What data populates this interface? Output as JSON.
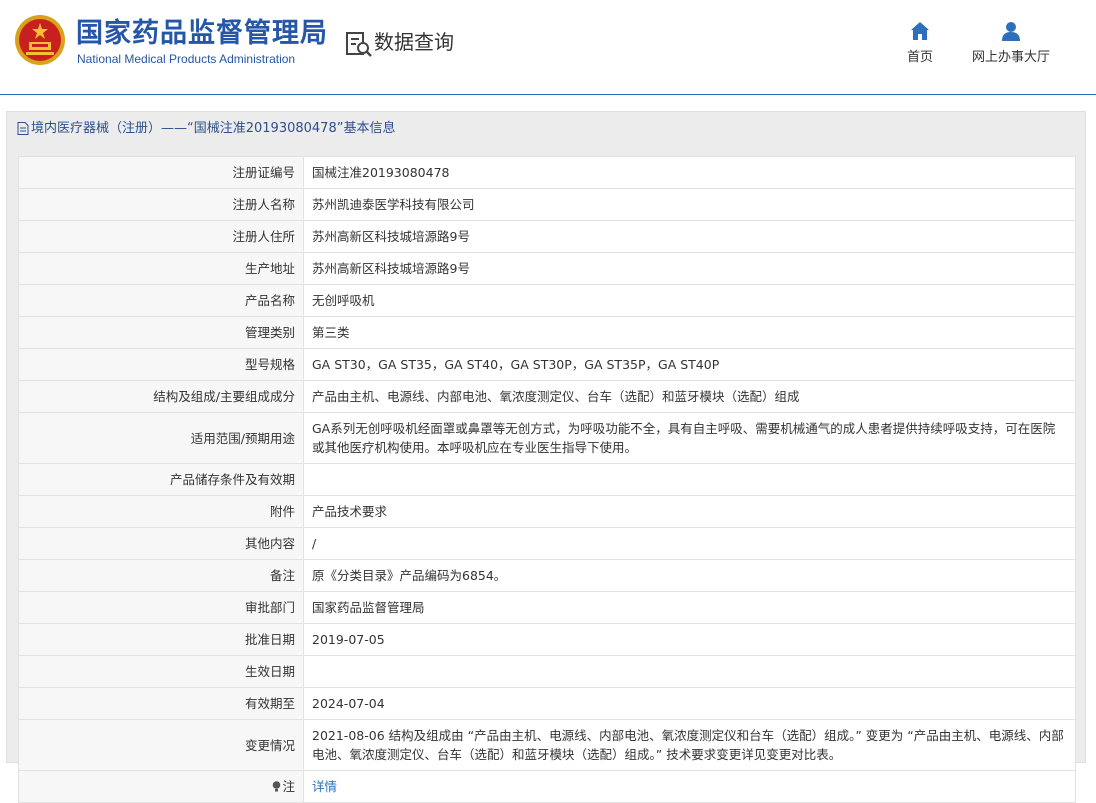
{
  "header": {
    "brand_cn": "国家药品监督管理局",
    "brand_en": "National Medical Products Administration",
    "query_title": "数据查询",
    "nav": [
      {
        "label": "首页",
        "icon": "home-icon"
      },
      {
        "label": "网上办事大厅",
        "icon": "user-icon"
      }
    ],
    "brand_color": "#2556a8"
  },
  "panel": {
    "title": "境内医疗器械（注册）——“国械注准20193080478”基本信息"
  },
  "rows": [
    {
      "key": "注册证编号",
      "value": "国械注准20193080478"
    },
    {
      "key": "注册人名称",
      "value": "苏州凯迪泰医学科技有限公司"
    },
    {
      "key": "注册人住所",
      "value": "苏州高新区科技城培源路9号"
    },
    {
      "key": "生产地址",
      "value": "苏州高新区科技城培源路9号"
    },
    {
      "key": "产品名称",
      "value": "无创呼吸机"
    },
    {
      "key": "管理类别",
      "value": "第三类"
    },
    {
      "key": "型号规格",
      "value": "GA ST30，GA ST35，GA ST40，GA ST30P，GA ST35P，GA ST40P"
    },
    {
      "key": "结构及组成/主要组成成分",
      "value": "产品由主机、电源线、内部电池、氧浓度测定仪、台车（选配）和蓝牙模块（选配）组成"
    },
    {
      "key": "适用范围/预期用途",
      "value": "GA系列无创呼吸机经面罩或鼻罩等无创方式，为呼吸功能不全，具有自主呼吸、需要机械通气的成人患者提供持续呼吸支持，可在医院或其他医疗机构使用。本呼吸机应在专业医生指导下使用。"
    },
    {
      "key": "产品储存条件及有效期",
      "value": ""
    },
    {
      "key": "附件",
      "value": "产品技术要求"
    },
    {
      "key": "其他内容",
      "value": "/"
    },
    {
      "key": "备注",
      "value": "原《分类目录》产品编码为6854。"
    },
    {
      "key": "审批部门",
      "value": "国家药品监督管理局"
    },
    {
      "key": "批准日期",
      "value": "2019-07-05"
    },
    {
      "key": "生效日期",
      "value": ""
    },
    {
      "key": "有效期至",
      "value": "2024-07-04"
    },
    {
      "key": "变更情况",
      "value": "2021-08-06 结构及组成由 “产品由主机、电源线、内部电池、氧浓度测定仪和台车（选配）组成。” 变更为 “产品由主机、电源线、内部电池、氧浓度测定仪、台车（选配）和蓝牙模块（选配）组成。” 技术要求变更详见变更对比表。"
    }
  ],
  "note": {
    "key": "注",
    "link": "详情"
  }
}
